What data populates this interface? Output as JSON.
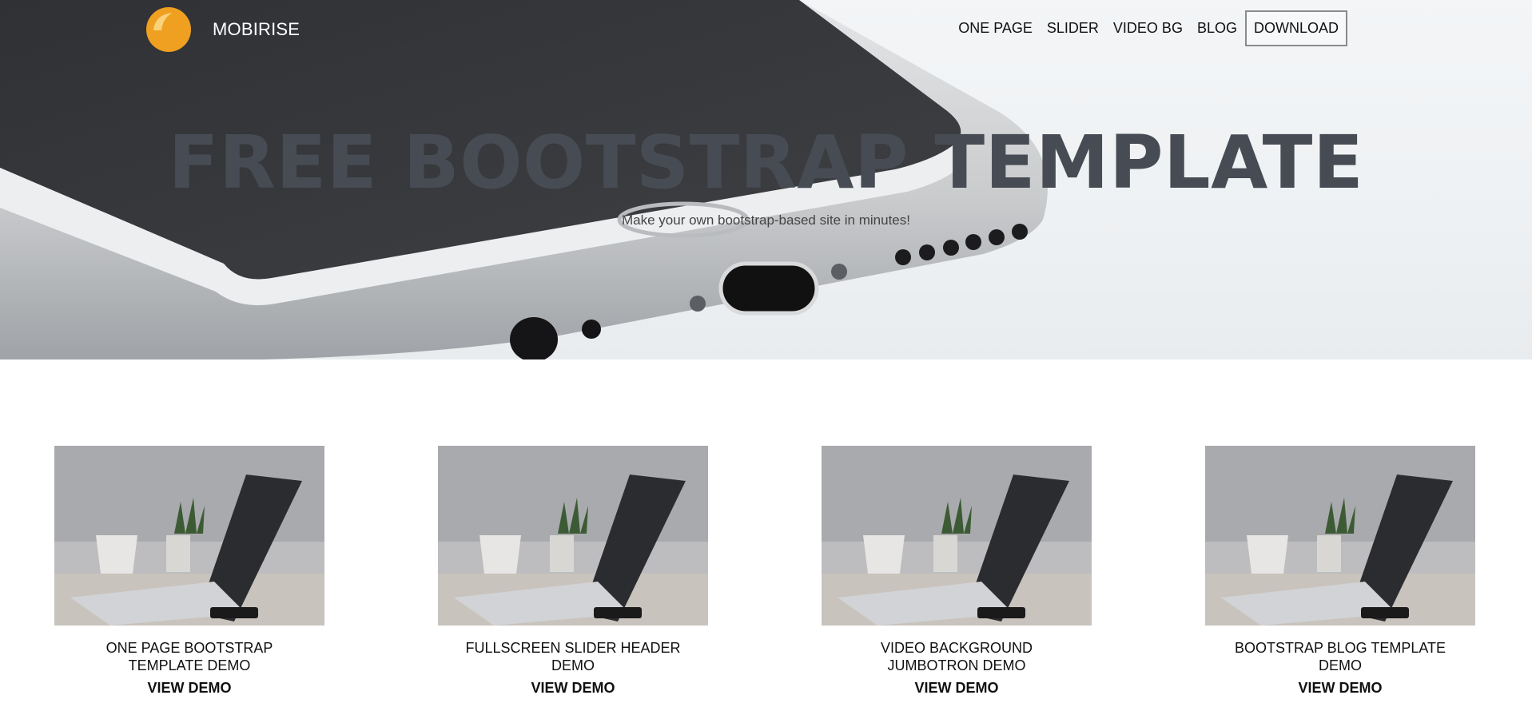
{
  "brand": {
    "name": "MOBIRISE",
    "logo_icon": "mobirise-logo-icon"
  },
  "nav": {
    "items": [
      "ONE PAGE",
      "SLIDER",
      "VIDEO BG",
      "BLOG"
    ],
    "download": "DOWNLOAD"
  },
  "hero": {
    "title": "FREE BOOTSTRAP TEMPLATE",
    "subtitle": "Make your own bootstrap-based site in minutes!"
  },
  "cards": [
    {
      "title": "ONE PAGE BOOTSTRAP TEMPLATE DEMO",
      "link": "VIEW DEMO"
    },
    {
      "title": "FULLSCREEN SLIDER HEADER DEMO",
      "link": "VIEW DEMO"
    },
    {
      "title": "VIDEO BACKGROUND JUMBOTRON DEMO",
      "link": "VIEW DEMO"
    },
    {
      "title": "BOOTSTRAP BLOG TEMPLATE DEMO",
      "link": "VIEW DEMO"
    }
  ],
  "colors": {
    "logo_orange": "#f0a020",
    "hero_title": "#474c54"
  }
}
